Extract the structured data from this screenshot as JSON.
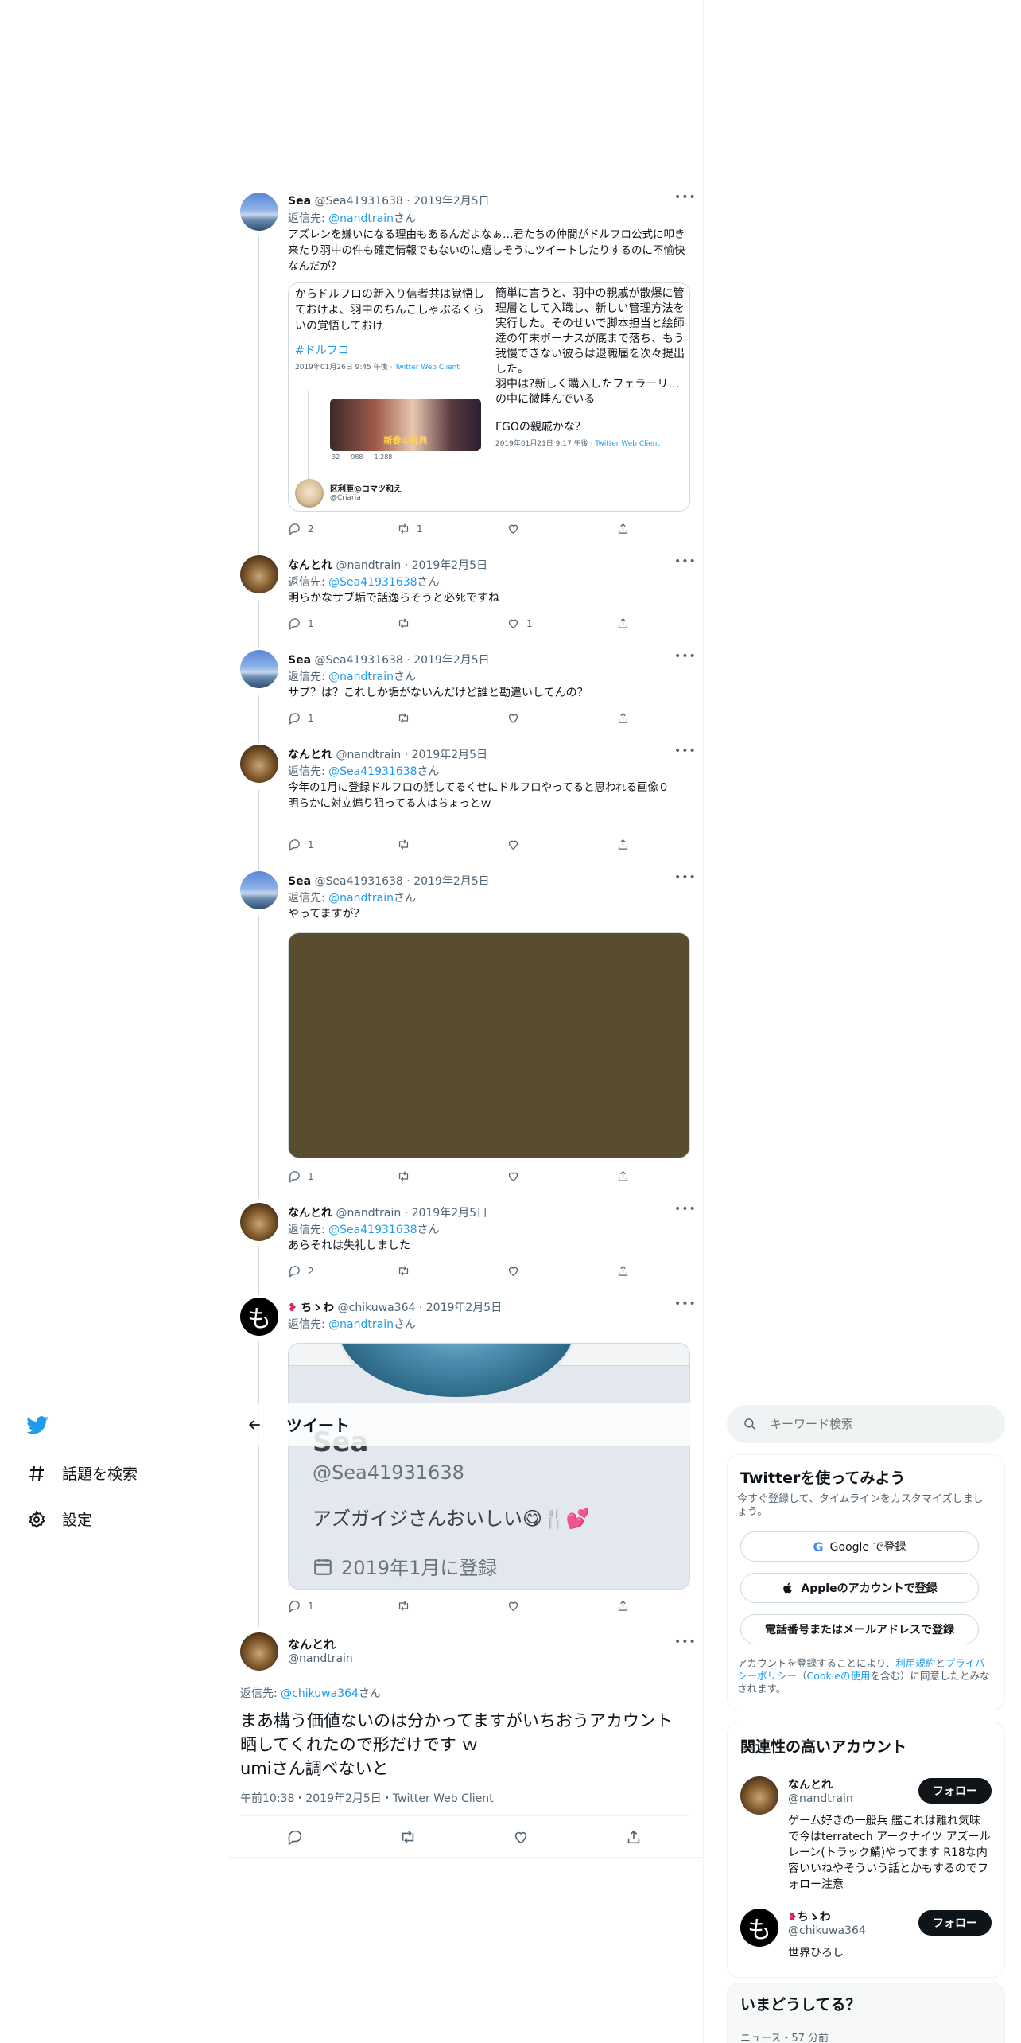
{
  "nav": {
    "explore_label": "話題を検索",
    "settings_label": "設定"
  },
  "header": {
    "title": "ツイート"
  },
  "tweets": [
    {
      "name": "Sea",
      "handle": "@Sea41931638",
      "date": "2019年2月5日",
      "reply_prefix": "返信先: ",
      "reply_to": "@nandtrain",
      "reply_suffix": "さん",
      "text": "アズレンを嫌いになる理由もあるんだよなぁ…君たちの仲間がドルフロ公式に叩き来たり羽中の件も確定情報でもないのに嬉しそうにツイートしたりするのに不愉快なんだが？",
      "replies": "2",
      "retweets": "1",
      "likes": ""
    },
    {
      "name": "なんとれ",
      "handle": "@nandtrain",
      "date": "2019年2月5日",
      "reply_prefix": "返信先: ",
      "reply_to": "@Sea41931638",
      "reply_suffix": "さん",
      "text": "明らかなサブ垢で話逸らそうと必死ですね",
      "replies": "1",
      "retweets": "",
      "likes": "1"
    },
    {
      "name": "Sea",
      "handle": "@Sea41931638",
      "date": "2019年2月5日",
      "reply_prefix": "返信先: ",
      "reply_to": "@nandtrain",
      "reply_suffix": "さん",
      "text": "サブ？は？これしか垢がないんだけど誰と勘違いしてんの？",
      "replies": "1",
      "retweets": "",
      "likes": ""
    },
    {
      "name": "なんとれ",
      "handle": "@nandtrain",
      "date": "2019年2月5日",
      "reply_prefix": "返信先: ",
      "reply_to": "@Sea41931638",
      "reply_suffix": "さん",
      "text": "今年の1月に登録ドルフロの話してるくせにドルフロやってると思われる画像０\n明らかに対立煽り狙ってる人はちょっとｗ",
      "replies": "1",
      "retweets": "",
      "likes": ""
    },
    {
      "name": "Sea",
      "handle": "@Sea41931638",
      "date": "2019年2月5日",
      "reply_prefix": "返信先: ",
      "reply_to": "@nandtrain",
      "reply_suffix": "さん",
      "text": "やってますが？",
      "replies": "1",
      "retweets": "",
      "likes": ""
    },
    {
      "name": "なんとれ",
      "handle": "@nandtrain",
      "date": "2019年2月5日",
      "reply_prefix": "返信先: ",
      "reply_to": "@Sea41931638",
      "reply_suffix": "さん",
      "text": "あらそれは失礼しました",
      "replies": "2",
      "retweets": "",
      "likes": ""
    },
    {
      "name": "ちゝわ",
      "handle": "@chikuwa364",
      "date": "2019年2月5日",
      "reply_prefix": "返信先: ",
      "reply_to": "@nandtrain",
      "reply_suffix": "さん",
      "text": "",
      "replies": "1",
      "retweets": "",
      "likes": ""
    }
  ],
  "embed": {
    "left_text": "からドルフロの新入り信者共は覚悟しておけよ、羽中のちんこしゃぶるくらいの覚悟しておけ",
    "hashtag": "#ドルフロ",
    "left_meta": "2019年01月26日 9:45 午後 · ",
    "client": "Twitter Web Client",
    "banner_text": "新春の祝典",
    "stat_replies": "32",
    "stat_rts": "988",
    "stat_likes": "1,288",
    "quoted_name": "区利亜@コマツ和え",
    "quoted_handle": "@Criaria",
    "right_text": "簡単に言うと、羽中の親戚が散爆に管理層として入職し、新しい管理方法を実行した。そのせいで脚本担当と絵師達の年末ボーナスが底まで落ち、もう我慢できない彼らは退職届を次々提出した。\n羽中は?新しく購入したフェラーリ…の中に微睡んでいる\n〜〜〜〜",
    "right_tail": "FGOの親戚かな？",
    "right_meta": "2019年01月21日 9:17 午後 · "
  },
  "profile_shot": {
    "name": "Sea",
    "handle": "@Sea41931638",
    "bio": "アズガイジさんおいしい😋🍴💕",
    "joined": "2019年1月に登録"
  },
  "main_tweet": {
    "name": "なんとれ",
    "handle": "@nandtrain",
    "reply_prefix": "返信先: ",
    "reply_to": "@chikuwa364",
    "reply_suffix": "さん",
    "text": "まあ構う価値ないのは分かってますがいちおうアカウント晒してくれたので形だけです ｗ\numiさん調べないと",
    "meta": "午前10:38・2019年2月5日・Twitter Web Client"
  },
  "search": {
    "placeholder": "キーワード検索"
  },
  "signup": {
    "title": "Twitterを使ってみよう",
    "subtitle": "今すぐ登録して、タイムラインをカスタマイズしましょう。",
    "google": "Google で登録",
    "apple": "Appleのアカウントで登録",
    "phone": "電話番号またはメールアドレスで登録",
    "terms_pre": "アカウントを登録することにより、",
    "terms_link": "利用規約",
    "terms_and": "と",
    "privacy_link": "プライバシーポリシー",
    "cookie_pre": "（",
    "cookie_link": "Cookieの使用",
    "terms_post": "を含む）に同意したとみなされます。"
  },
  "related": {
    "title": "関連性の高いアカウント",
    "follow_label": "フォロー",
    "accounts": [
      {
        "name": "なんとれ",
        "handle": "@nandtrain",
        "bio": "ゲーム好きの一般兵 艦これは離れ気味で今はterratech アークナイツ アズールレーン(トラック鯖)やってます R18な内容いいねやそういう話とかもするのでフォロー注意"
      },
      {
        "name": "ちゝわ",
        "handle": "@chikuwa364",
        "bio": "世界ひろし"
      }
    ]
  },
  "trends": {
    "title": "いまどうしてる？",
    "item_meta": "ニュース・57 分前"
  },
  "colors": {
    "accent": "#1d9bf0",
    "text": "#0f1419",
    "muted": "#536471",
    "border": "#cfd9de"
  }
}
